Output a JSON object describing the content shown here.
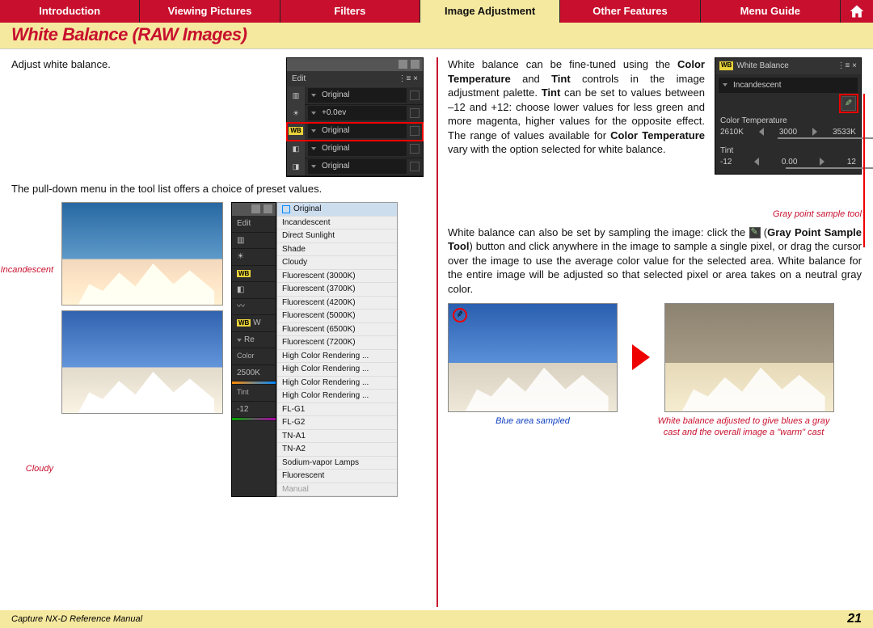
{
  "nav": {
    "tabs": [
      "Introduction",
      "Viewing Pictures",
      "Filters",
      "Image Adjustment",
      "Other Features",
      "Menu Guide"
    ],
    "active_index": 3
  },
  "title": "White Balance (RAW Images)",
  "left": {
    "intro": "Adjust white balance.",
    "panel1": {
      "header": "Edit",
      "rows": [
        {
          "icon": "exposure",
          "value": "Original"
        },
        {
          "icon": "ev",
          "value": "+0.0ev"
        },
        {
          "icon": "wb",
          "value": "Original",
          "highlight": true
        },
        {
          "icon": "tone",
          "value": "Original"
        },
        {
          "icon": "bw",
          "value": "Original"
        }
      ]
    },
    "pulldown_text": "The pull-down menu in the tool list offers a choice of preset values.",
    "captions": {
      "incandescent": "Incandescent",
      "cloudy": "Cloudy"
    },
    "dropdown": {
      "selected": "Original",
      "options": [
        "Incandescent",
        "Direct Sunlight",
        "Shade",
        "Cloudy",
        "Fluorescent (3000K)",
        "Fluorescent (3700K)",
        "Fluorescent (4200K)",
        "Fluorescent (5000K)",
        "Fluorescent (6500K)",
        "Fluorescent (7200K)",
        "High Color Rendering ...",
        "High Color Rendering ...",
        "High Color Rendering ...",
        "High Color Rendering ...",
        "FL-G1",
        "FL-G2",
        "TN-A1",
        "TN-A2",
        "Sodium-vapor Lamps",
        "Fluorescent"
      ],
      "disabled": "Manual"
    },
    "panel2_extra": {
      "wb_label": "W",
      "re_label": "Re",
      "color_label": "Color",
      "color_min": "2500K",
      "tint_label": "Tint",
      "tint_min": "-12"
    }
  },
  "right": {
    "para1_a": "White balance can be fine-tuned using the ",
    "para1_b": "Color Temperature",
    "para1_c": " and ",
    "para1_d": "Tint",
    "para1_e": " controls in the image adjustment palette. ",
    "para1_f": "Tint",
    "para1_g": " can be set to values between –12 and +12: choose lower values for less green and more magenta, higher values for the opposite effect. The range of values available for ",
    "para1_h": "Color Temperature",
    "para1_i": " vary with the option selected for white balance.",
    "wbpalette": {
      "title": "White Balance",
      "wb_icon_label": "WB",
      "preset": "Incandescent",
      "ct_label": "Color Temperature",
      "ct_min": "2610K",
      "ct_val": "3000",
      "ct_max": "3533K",
      "tint_label": "Tint",
      "tint_min": "-12",
      "tint_val": "0.00",
      "tint_max": "12"
    },
    "gray_tool_caption": "Gray point sample tool",
    "para2_a": "White balance can also be set by sampling the image: click the ",
    "para2_b": " (",
    "para2_c": "Gray Point Sample Tool",
    "para2_d": ") button and click anywhere in the image to sample a single pixel, or drag the cursor over the image to use the average color value for the selected area. White balance for the entire image will be adjusted so that selected pixel or area takes on a neutral gray color.",
    "cap_blue": "Blue area sampled",
    "cap_warm": "White balance adjusted to give blues a gray cast and the overall image a \"warm\" cast"
  },
  "footer": {
    "manual": "Capture NX-D Reference Manual",
    "page": "21"
  }
}
